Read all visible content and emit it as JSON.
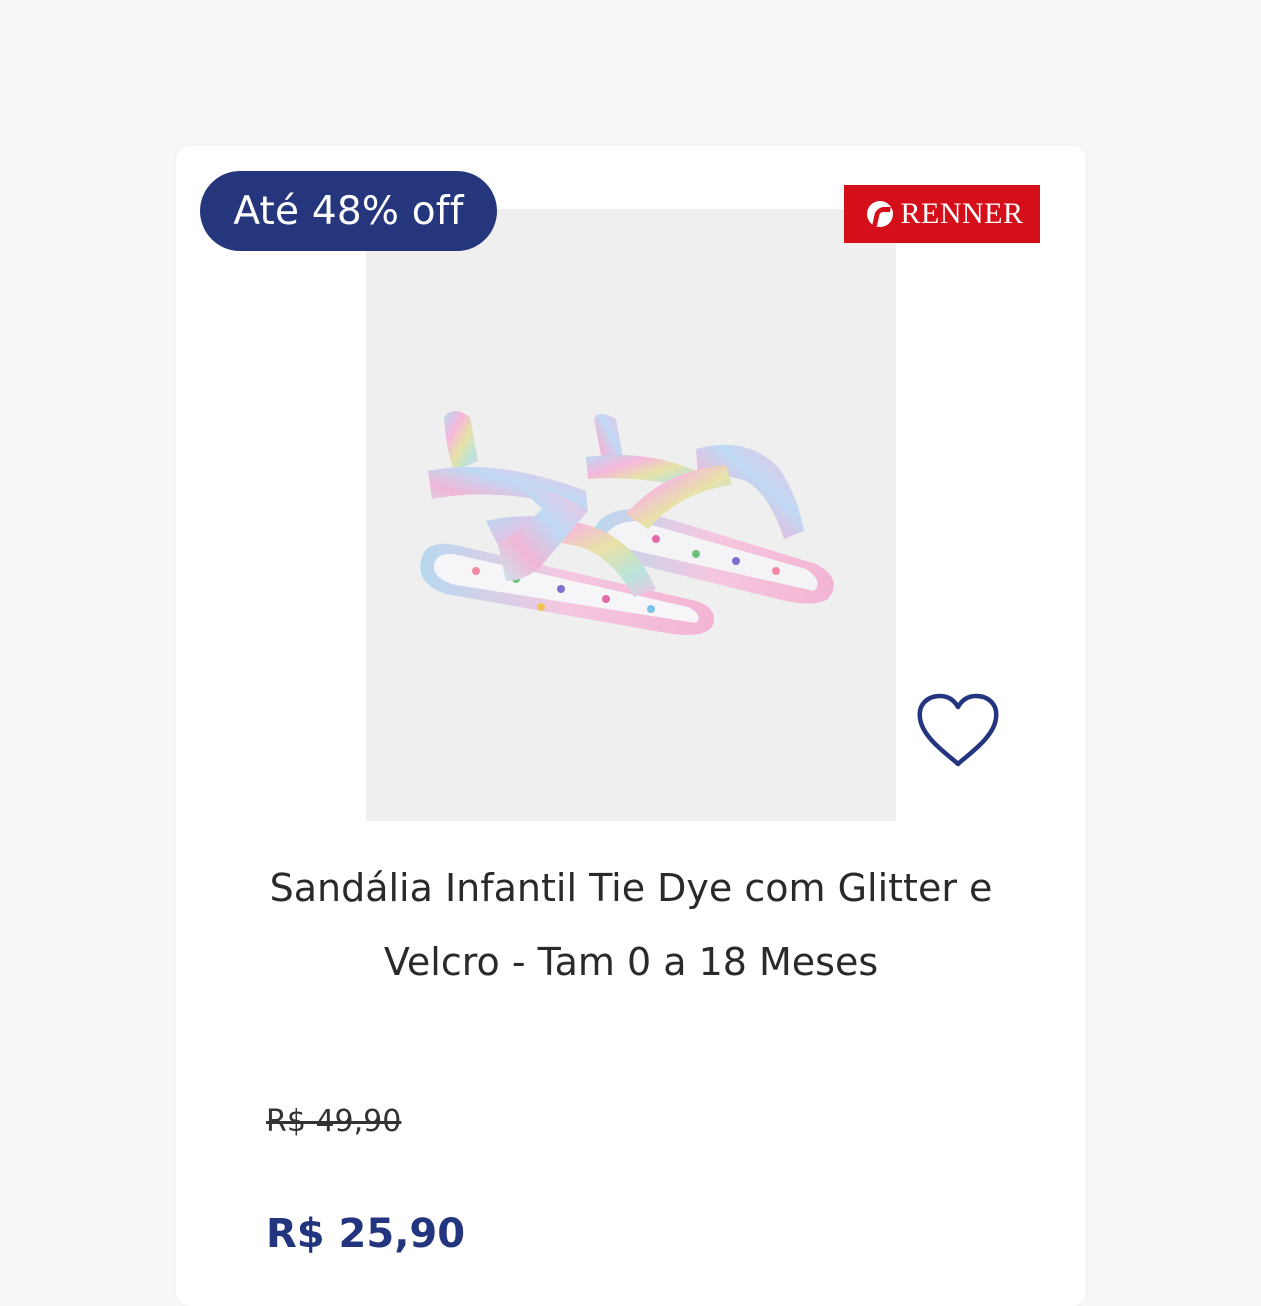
{
  "colors": {
    "badge_bg": "#25367d",
    "brand_bg": "#d40f19",
    "price": "#24357f",
    "heart_stroke": "#24357f"
  },
  "product": {
    "discount_badge": "Até 48% off",
    "brand_name": "RENNER",
    "title": "Sandália Infantil Tie Dye com Glitter e Velcro - Tam 0 a 18 Meses",
    "old_price": "R$ 49,90",
    "price": "R$ 25,90",
    "favorite_icon": "heart-outline-icon",
    "image": "tie-dye-baby-sandals"
  }
}
